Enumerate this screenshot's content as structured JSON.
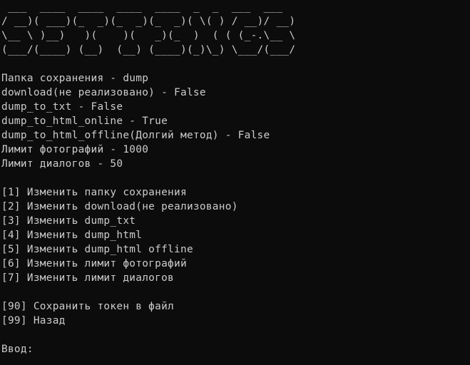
{
  "banner": [
    " ___  ____  ____  ____  ____  _  _  ___  ___",
    "/ __)( ___)(_  _)(_  _)(_  _)( \\( ) / __)/ __)",
    "\\__ \\ )__)   )(    )(   _)(_  )  ( ( (_-.\\__ \\",
    "(___/(____) (__)  (__) (____)(_)\\_) \\___/(___/"
  ],
  "settings": {
    "folder": "Папка сохранения - dump",
    "download": "download(не реализовано) - False",
    "dump_to_txt": "dump_to_txt - False",
    "dump_to_html_online": "dump_to_html_online - True",
    "dump_to_html_offline": "dump_to_html_offline(Долгий метод) - False",
    "photo_limit": "Лимит фотографий - 1000",
    "dialog_limit": "Лимит диалогов - 50"
  },
  "menu": {
    "item1": "[1] Изменить папку сохранения",
    "item2": "[2] Изменить download(не реализовано)",
    "item3": "[3] Изменить dump_txt",
    "item4": "[4] Изменить dump_html",
    "item5": "[5] Изменить dump_html offline",
    "item6": "[6] Изменить лимит фотографий",
    "item7": "[7] Изменить лимит диалогов",
    "item90": "[90] Сохранить токен в файл",
    "item99": "[99] Назад"
  },
  "prompt": {
    "label": "Ввод: ",
    "value": ""
  }
}
